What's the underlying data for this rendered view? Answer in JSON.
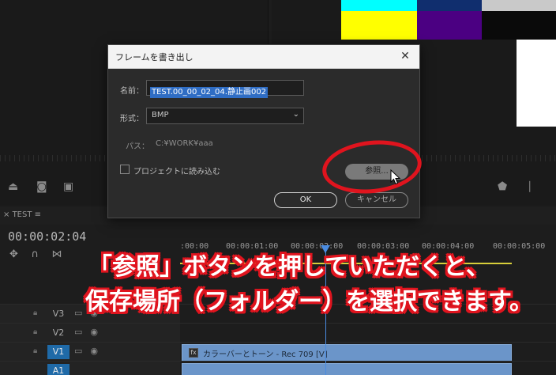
{
  "colors": {
    "accent_red": "#e0141e",
    "selection_blue": "#2f6dc4",
    "clip_blue": "#6b95c9",
    "playhead": "#4a8be0"
  },
  "color_bars": [
    "#00ffff",
    "#102e6e",
    "#c9c9c9",
    "#ffff00",
    "#4b0082",
    "#ffffff"
  ],
  "dialog": {
    "title": "フレームを書き出し",
    "close_icon": "close-icon",
    "name_label": "名前：",
    "name_value": "TEST.00_00_02_04.静止画002",
    "format_label": "形式：",
    "format_value": "BMP",
    "path_label": "パス：",
    "path_value": "C:¥WORK¥aaa",
    "import_label": "プロジェクトに読み込む",
    "browse_label": "参照...",
    "ok_label": "OK",
    "cancel_label": "キャンセル"
  },
  "timeline": {
    "tab": "TEST",
    "timecode": "00:00:02:04",
    "ruler_labels": [
      ":00:00",
      "00:00:01:00",
      "00:00:02:00",
      "00:00:03:00",
      "00:00:04:00",
      "00:00:05:00"
    ],
    "tracks": [
      {
        "name": "V3",
        "active": false,
        "clip": ""
      },
      {
        "name": "V2",
        "active": false,
        "clip": ""
      },
      {
        "name": "V1",
        "active": true,
        "clip": "カラーバーとトーン - Rec 709 [V]"
      },
      {
        "name": "A1",
        "active": true,
        "clip": ""
      }
    ],
    "clip_fx": "fx"
  },
  "caption": {
    "line1": "「参照」ボタンを押していただくと、",
    "line2": "保存場所（フォルダー）を選択できます。"
  }
}
